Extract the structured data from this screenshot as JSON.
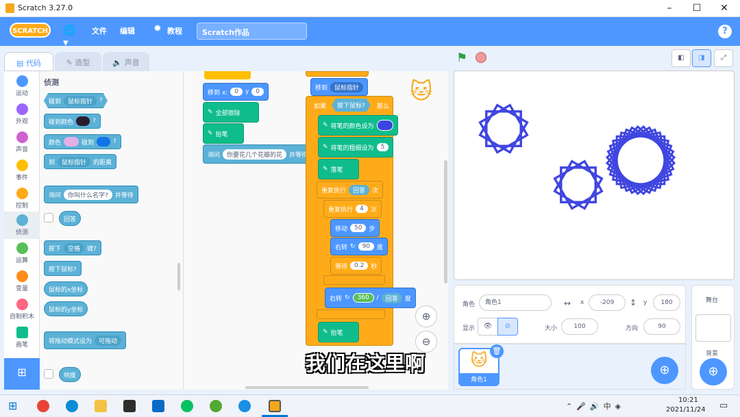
{
  "window": {
    "title": "Scratch 3.27.0",
    "minimize": "–",
    "maximize": "☐",
    "close": "✕"
  },
  "menubar": {
    "logo": "SCRATCH",
    "file": "文件",
    "edit": "编辑",
    "tutorials": "教程",
    "project_title": "Scratch作品",
    "help": "?"
  },
  "tabs": {
    "code": "代码",
    "costumes": "造型",
    "sounds": "声音"
  },
  "categories": [
    {
      "label": "运动",
      "color": "#4c97ff"
    },
    {
      "label": "外观",
      "color": "#9966ff"
    },
    {
      "label": "声音",
      "color": "#cf63cf"
    },
    {
      "label": "事件",
      "color": "#ffbf00"
    },
    {
      "label": "控制",
      "color": "#ffab19"
    },
    {
      "label": "侦测",
      "color": "#5cb1d6"
    },
    {
      "label": "运算",
      "color": "#59c059"
    },
    {
      "label": "变量",
      "color": "#ff8c1a"
    },
    {
      "label": "自制积木",
      "color": "#ff6680"
    },
    {
      "label": "画笔",
      "color": "#0fbd8c"
    }
  ],
  "palette": {
    "heading": "侦测",
    "touching": "碰到",
    "touching_opt": "鼠标指针",
    "q": "?",
    "touching_color": "碰到颜色",
    "color": "颜色",
    "color_touch": "碰到",
    "distance_to": "到",
    "distance_opt": "鼠标指针",
    "distance_suffix": "的距离",
    "ask": "询问",
    "ask_default": "你叫什么名字?",
    "ask_wait": "并等待",
    "answer": "回答",
    "key_pressed": "按下",
    "key_opt": "空格",
    "key_suffix": "键?",
    "mouse_down": "按下鼠标?",
    "mouse_x": "鼠标的x坐标",
    "mouse_y": "鼠标的y坐标",
    "drag_mode": "将拖动模式设为",
    "drag_opt": "可拖动",
    "loudness": "响度"
  },
  "code": {
    "left_stack": {
      "goto_xy": "移到 x:",
      "x": "0",
      "y_label": "y",
      "y": "0",
      "clear": "全部擦除",
      "pen_up": "抬笔",
      "ask": "询问",
      "ask_text": "你要花几个花瓣的花",
      "ask_wait": "并等待"
    },
    "right_stack": {
      "goto": "移到",
      "goto_opt": "鼠标指针",
      "if": "如果",
      "if_cond": "按下鼠标?",
      "then": "那么",
      "set_color": "将笔的颜色设为",
      "set_size": "将笔的粗细设为",
      "size": "5",
      "pen_down": "落笔",
      "repeat": "重复执行",
      "repeat_val": "回答",
      "times": "次",
      "repeat2": "重复执行",
      "repeat2_val": "4",
      "times2": "次",
      "move": "移动",
      "move_val": "50",
      "steps": "步",
      "turn": "右转",
      "turn_val": "90",
      "deg": "度",
      "wait": "等待",
      "wait_val": "0.2",
      "secs": "秒",
      "turn2": "右转",
      "turn2_num": "360",
      "div": "/",
      "turn2_den": "回答",
      "deg2": "度",
      "pen_up": "抬笔"
    }
  },
  "sprite_info": {
    "sprite_label": "角色",
    "sprite_name": "角色1",
    "x_label": "x",
    "x": "-209",
    "y_label": "y",
    "y": "180",
    "show_label": "显示",
    "size_label": "大小",
    "size": "100",
    "direction_label": "方向",
    "direction": "90"
  },
  "sprite_list": {
    "item": "角色1"
  },
  "stage_pane": {
    "title": "舞台",
    "backdrops": "背景"
  },
  "subtitle": "我们在这里啊",
  "taskbar": {
    "time": "10:21",
    "date": "2021/11/24"
  },
  "colors": {
    "brand": "#4d97ff",
    "pen_stroke": "#4046e0"
  }
}
